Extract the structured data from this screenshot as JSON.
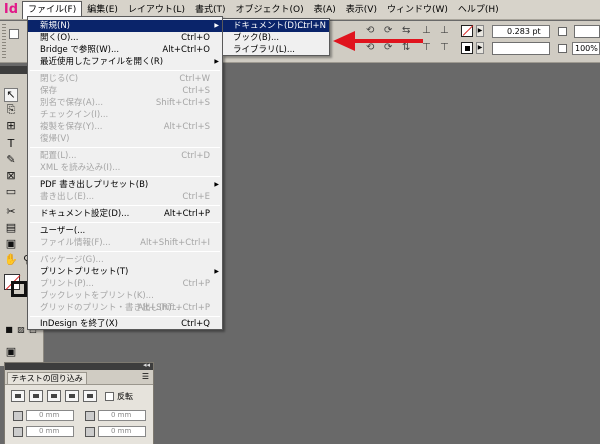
{
  "app": {
    "logo": "Id"
  },
  "menubar": [
    {
      "label": "ファイル(F)",
      "active": true
    },
    {
      "label": "編集(E)"
    },
    {
      "label": "レイアウト(L)"
    },
    {
      "label": "書式(T)"
    },
    {
      "label": "オブジェクト(O)"
    },
    {
      "label": "表(A)"
    },
    {
      "label": "表示(V)"
    },
    {
      "label": "ウィンドウ(W)"
    },
    {
      "label": "ヘルプ(H)"
    }
  ],
  "file_menu": {
    "items": [
      {
        "label": "新規(N)",
        "shortcut": "",
        "submenu": true,
        "highlighted": true
      },
      {
        "label": "開く(O)...",
        "shortcut": "Ctrl+O"
      },
      {
        "label": "Bridge で参照(W)...",
        "shortcut": "Alt+Ctrl+O"
      },
      {
        "label": "最近使用したファイルを開く(R)",
        "submenu": true
      },
      {
        "label": "閉じる(C)",
        "shortcut": "Ctrl+W",
        "disabled": true
      },
      {
        "label": "保存",
        "shortcut": "Ctrl+S",
        "disabled": true
      },
      {
        "label": "別名で保存(A)...",
        "shortcut": "Shift+Ctrl+S",
        "disabled": true
      },
      {
        "label": "チェックイン(I)...",
        "disabled": true
      },
      {
        "label": "複製を保存(Y)...",
        "shortcut": "Alt+Ctrl+S",
        "disabled": true
      },
      {
        "label": "復帰(V)",
        "disabled": true
      },
      {
        "label": "配置(L)...",
        "shortcut": "Ctrl+D",
        "disabled": true
      },
      {
        "label": "XML を読み込み(I)...",
        "disabled": true
      },
      {
        "label": "PDF 書き出しプリセット(B)",
        "submenu": true
      },
      {
        "label": "書き出し(E)...",
        "shortcut": "Ctrl+E",
        "disabled": true
      },
      {
        "label": "ドキュメント設定(D)...",
        "shortcut": "Alt+Ctrl+P"
      },
      {
        "label": "ユーザー(...",
        "shortcut": ""
      },
      {
        "label": "ファイル情報(F)...",
        "shortcut": "Alt+Shift+Ctrl+I",
        "disabled": true
      },
      {
        "label": "パッケージ(G)...",
        "disabled": true
      },
      {
        "label": "プリントプリセット(T)",
        "submenu": true
      },
      {
        "label": "プリント(P)...",
        "shortcut": "Ctrl+P",
        "disabled": true
      },
      {
        "label": "ブックレットをプリント(K)...",
        "disabled": true
      },
      {
        "label": "グリッドのプリント・書き出し(R)...",
        "shortcut": "Alt+Shift+Ctrl+P",
        "disabled": true
      },
      {
        "label": "InDesign を終了(X)",
        "shortcut": "Ctrl+Q"
      }
    ]
  },
  "new_submenu": {
    "items": [
      {
        "label": "ドキュメント(D)...",
        "shortcut": "Ctrl+N",
        "highlighted": true
      },
      {
        "label": "ブック(B)..."
      },
      {
        "label": "ライブラリ(L)..."
      }
    ]
  },
  "controlbar": {
    "stroke_weight": "0.283 pt",
    "scale": "100%"
  },
  "text_wrap_panel": {
    "title": "テキストの回り込み",
    "invert_label": "反転",
    "offset_value": "0 mm"
  },
  "colors": {
    "menu_highlight": "#0a246a",
    "annotation_arrow": "#e0141e",
    "workspace": "#696969",
    "logo": "#e11b89"
  }
}
